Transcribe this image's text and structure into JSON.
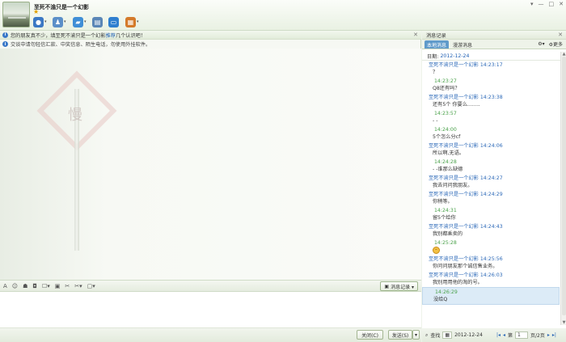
{
  "header": {
    "contact_name": "至死不渝只是一个幻影",
    "star": "★",
    "toolbar": [
      {
        "icon": "camera-icon",
        "color": "#3b78c4"
      },
      {
        "icon": "user-robot-icon",
        "color": "#5b8fc8"
      },
      {
        "icon": "folder-icon",
        "color": "#3f8ed6"
      },
      {
        "icon": "document-icon",
        "color": "#5a86b6"
      },
      {
        "icon": "monitor-icon",
        "color": "#2f7fcf"
      },
      {
        "icon": "app-icon",
        "color": "#d47a2a"
      }
    ],
    "window_controls": [
      "▾",
      "—",
      "□",
      "✕"
    ]
  },
  "left": {
    "notice1_prefix": "您的朋友真不少，填至死不渝只是一个幻影",
    "notice1_link": "推荐",
    "notice1_suffix": "几个认识吧！",
    "notice1_close": "✕",
    "notice2": "交谈中请勿轻信汇款、中奖信息、陌生电话，勿使用外挂软件。",
    "sign_text": "慢",
    "input_toolbar": [
      "A",
      "☺",
      "☗",
      "◘",
      "☐▾",
      "▣",
      "✂",
      "✂▾",
      "▢▾"
    ],
    "history_button": "消息记录 ▾",
    "close_button": "关闭(C)",
    "send_button": "发送(S)",
    "send_arrow": "▾"
  },
  "right": {
    "title": "消息记录",
    "close": "✕",
    "tabs": [
      "本地消息",
      "漫游消息"
    ],
    "tools": {
      "icon_label": "▾",
      "more": "更多"
    },
    "date_label": "日期:",
    "date_value": "2012-12-24",
    "messages": [
      {
        "me": false,
        "header": "至死不渝只是一个幻影 14:23:17",
        "body": "？"
      },
      {
        "me": true,
        "header": "14:23:27",
        "body": "Q8还有吗？"
      },
      {
        "me": false,
        "header": "至死不渝只是一个幻影 14:23:38",
        "body": "还有5个 你要么........"
      },
      {
        "me": true,
        "header": "14:23:57",
        "body": "- -"
      },
      {
        "me": true,
        "header": "14:24:00",
        "body": "5个怎么分cf"
      },
      {
        "me": false,
        "header": "至死不渝只是一个幻影 14:24:06",
        "body": "所以啊,无语。"
      },
      {
        "me": true,
        "header": "14:24:28",
        "body": "- -谁那么缺德"
      },
      {
        "me": false,
        "header": "至死不渝只是一个幻影 14:24:27",
        "body": "   我去问问我朋友。"
      },
      {
        "me": false,
        "header": "至死不渝只是一个幻影 14:24:29",
        "body": "你稍等。"
      },
      {
        "me": true,
        "header": "14:24:31",
        "body": "留5个给你"
      },
      {
        "me": false,
        "header": "至死不渝只是一个幻影 14:24:43",
        "body": "我别都乘卖的"
      },
      {
        "me": true,
        "header": "14:25:28",
        "body": "",
        "emoji": true
      },
      {
        "me": false,
        "header": "至死不渝只是一个幻影 14:25:56",
        "body": "你问问朋友那个诚信售业务。"
      },
      {
        "me": false,
        "header": "至死不渝只是一个幻影 14:26:03",
        "body": "我别用用他的淘的号。"
      },
      {
        "me": true,
        "header": "14:26:29",
        "body": "没给Q",
        "highlight": true
      }
    ],
    "footer": {
      "find": "查找",
      "date": "2012-12-24",
      "page_label": "第",
      "page_value": "1",
      "page_total": "页/2页"
    }
  }
}
